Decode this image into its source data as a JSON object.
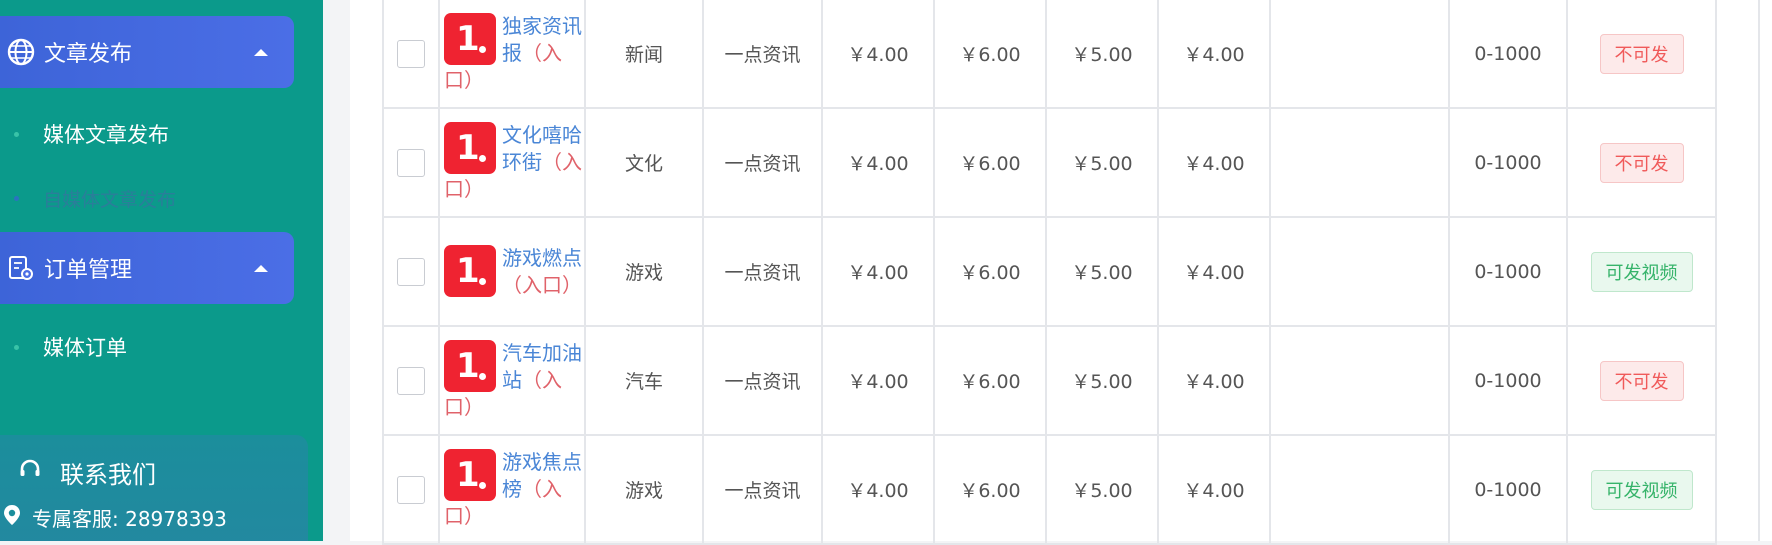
{
  "sidebar": {
    "groups": [
      {
        "title": "文章发布",
        "icon": "globe-icon"
      },
      {
        "title": "订单管理",
        "icon": "order-settings-icon"
      }
    ],
    "items": [
      {
        "label": "媒体文章发布",
        "state": "normal"
      },
      {
        "label": "自媒体文章发布",
        "state": "faded"
      },
      {
        "label": "媒体订单",
        "state": "normal"
      }
    ],
    "contact": {
      "title": "联系我们",
      "service_line": "专属客服: 28978393"
    }
  },
  "table": {
    "rows": [
      {
        "name_line1": "独家资讯",
        "name_line2": "报",
        "entry": "（入口）",
        "category": "新闻",
        "platform": "一点资讯",
        "p1": "￥4.00",
        "p2": "￥6.00",
        "p3": "￥5.00",
        "p4": "￥4.00",
        "extra": "",
        "range": "0-1000",
        "status": "不可发",
        "status_type": "no"
      },
      {
        "name_line1": "文化嘻哈",
        "name_line2": "环街",
        "entry": "（入口）",
        "category": "文化",
        "platform": "一点资讯",
        "p1": "￥4.00",
        "p2": "￥6.00",
        "p3": "￥5.00",
        "p4": "￥4.00",
        "extra": "",
        "range": "0-1000",
        "status": "不可发",
        "status_type": "no"
      },
      {
        "name_line1": "游戏燃点",
        "name_line2": "",
        "entry": "（入口）",
        "category": "游戏",
        "platform": "一点资讯",
        "p1": "￥4.00",
        "p2": "￥6.00",
        "p3": "￥5.00",
        "p4": "￥4.00",
        "extra": "",
        "range": "0-1000",
        "status": "可发视频",
        "status_type": "ok"
      },
      {
        "name_line1": "汽车加油",
        "name_line2": "站",
        "entry": "（入口）",
        "category": "汽车",
        "platform": "一点资讯",
        "p1": "￥4.00",
        "p2": "￥6.00",
        "p3": "￥5.00",
        "p4": "￥4.00",
        "extra": "",
        "range": "0-1000",
        "status": "不可发",
        "status_type": "no"
      },
      {
        "name_line1": "游戏焦点",
        "name_line2": "榜",
        "entry": "（入口）",
        "category": "游戏",
        "platform": "一点资讯",
        "p1": "￥4.00",
        "p2": "￥6.00",
        "p3": "￥5.00",
        "p4": "￥4.00",
        "extra": "",
        "range": "0-1000",
        "status": "可发视频",
        "status_type": "ok"
      }
    ]
  },
  "colors": {
    "sidebar_bg": "#0b9a8b",
    "group_header": "#4b6ee6",
    "link": "#4a86d6",
    "entry": "#e0626a",
    "logo_red": "#ef2331"
  }
}
